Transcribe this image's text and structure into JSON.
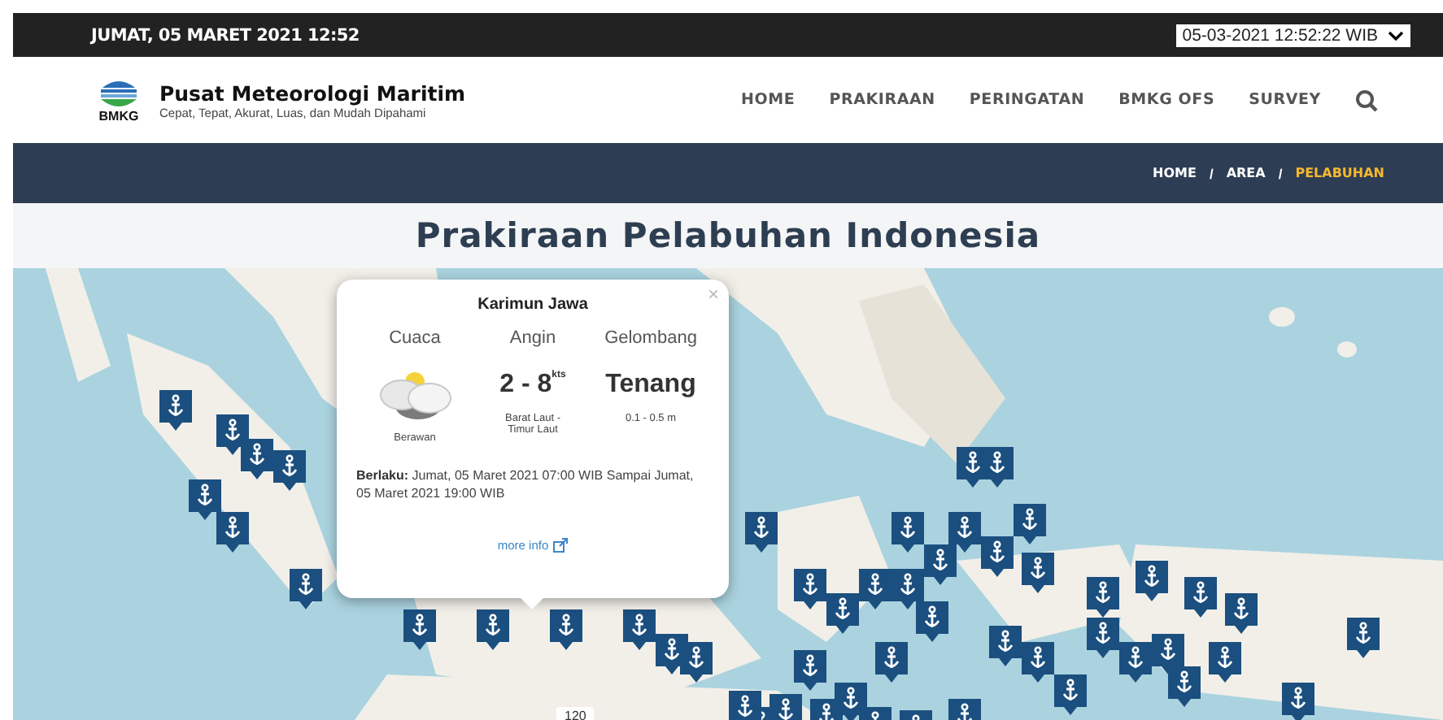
{
  "topbar": {
    "date": "JUMAT, 05 MARET 2021 12:52",
    "time_select": "05-03-2021 12:52:22 WIB"
  },
  "header": {
    "title": "Pusat Meteorologi Maritim",
    "tagline": "Cepat, Tepat, Akurat, Luas, dan Mudah Dipahami",
    "logo_text": "BMKG"
  },
  "nav": [
    {
      "label": "HOME"
    },
    {
      "label": "PRAKIRAAN"
    },
    {
      "label": "PERINGATAN"
    },
    {
      "label": "BMKG OFS"
    },
    {
      "label": "SURVEY"
    }
  ],
  "breadcrumb": [
    {
      "label": "HOME",
      "selected": false
    },
    {
      "label": "AREA",
      "selected": false
    },
    {
      "label": "PELABUHAN",
      "selected": true
    }
  ],
  "breadcrumb_separators": [
    "/",
    "/"
  ],
  "page_title": "Prakiraan Pelabuhan Indonesia",
  "map": {
    "kind": "picture",
    "cluster_count": "120"
  },
  "popup": {
    "title": "Karimun Jawa",
    "close": "×",
    "columns": [
      {
        "heading": "Cuaca",
        "kind": "weather",
        "caption": "Berawan"
      },
      {
        "heading": "Angin",
        "kind": "wind",
        "value": "2 - 8",
        "unit": "kts",
        "caption": "Barat Laut - Timur Laut"
      },
      {
        "heading": "Gelombang",
        "kind": "wave",
        "value": "Tenang",
        "caption": "0.1 - 0.5 m"
      }
    ],
    "validity": "**Berlaku:** Jumat, 05 Maret 2021 07:00 WIB Sampai Jumat, 05 Maret 2021 19:00 WIB",
    "link": "more info"
  }
}
